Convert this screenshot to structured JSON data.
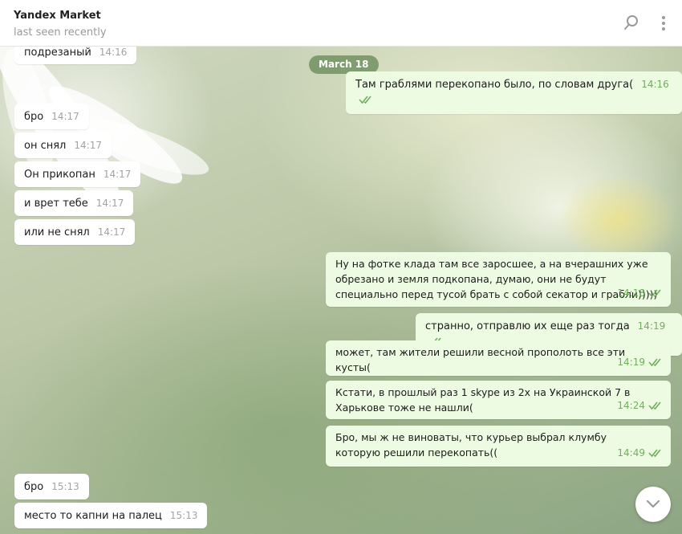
{
  "header": {
    "title": "Yandex Market",
    "status": "last seen recently"
  },
  "date_pill": "March 18",
  "messages": [
    {
      "dir": "in",
      "text": "подрезаный",
      "time": "14:16"
    },
    {
      "dir": "out",
      "text": "Там граблями перекопано было, по словам друга(",
      "time": "14:16"
    },
    {
      "dir": "in",
      "text": "бро",
      "time": "14:17"
    },
    {
      "dir": "in",
      "text": "он снял",
      "time": "14:17"
    },
    {
      "dir": "in",
      "text": "Он прикопан",
      "time": "14:17"
    },
    {
      "dir": "in",
      "text": "и врет тебе",
      "time": "14:17"
    },
    {
      "dir": "in",
      "text": "или не снял",
      "time": "14:17"
    },
    {
      "dir": "out",
      "text": "Ну на фотке клада там все заросшее, а на вчерашних уже обрезано и земля подкопана, думаю, они не будут специально перед тусой брать с собой секатор и грабли)))))",
      "time": "14:18"
    },
    {
      "dir": "out",
      "text": "странно, отправлю их еще раз тогда",
      "time": "14:19"
    },
    {
      "dir": "out",
      "text": "может, там жители решили весной прополоть все эти кусты(",
      "time": "14:19"
    },
    {
      "dir": "out",
      "text": "Кстати, в прошлый раз 1 skype из 2х на Украинской 7 в Харькове тоже не нашли(",
      "time": "14:24"
    },
    {
      "dir": "out",
      "text": "Бро, мы ж не виноваты, что курьер выбрал клумбу которую решили перекопать((",
      "time": "14:49"
    },
    {
      "dir": "in",
      "text": "бро",
      "time": "15:13"
    },
    {
      "dir": "in",
      "text": "место то капни на палец",
      "time": "15:13"
    }
  ],
  "colors": {
    "outgoing_bubble": "#eefbe3",
    "incoming_bubble": "#ffffff",
    "read_check": "#6fae5b",
    "date_pill": "#698c5a"
  },
  "icons": {
    "search": "search-icon",
    "menu": "more-vertical-icon",
    "scroll_down": "chevron-down-icon",
    "read_status": "double-check-icon"
  }
}
